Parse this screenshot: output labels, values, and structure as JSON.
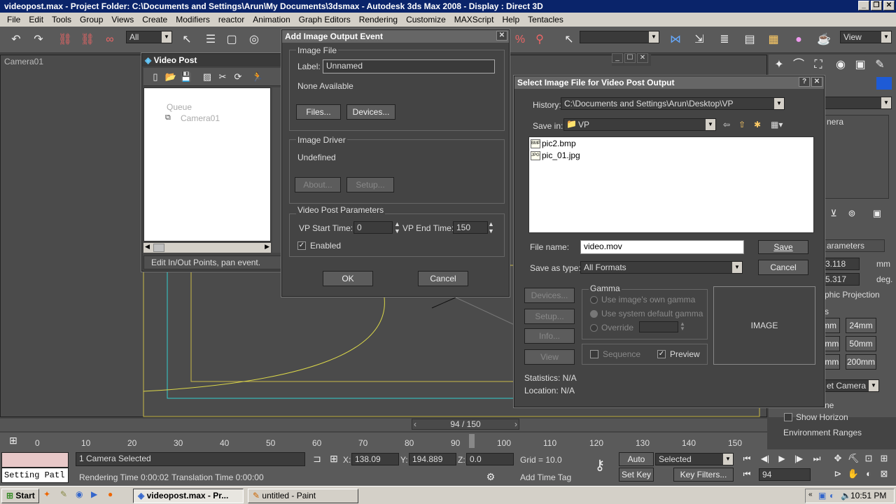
{
  "app": {
    "title": "videopost.max    - Project Folder: C:\\Documents and Settings\\Arun\\My Documents\\3dsmax     - Autodesk 3ds Max 2008      - Display : Direct 3D"
  },
  "menu": [
    "File",
    "Edit",
    "Tools",
    "Group",
    "Views",
    "Create",
    "Modifiers",
    "reactor",
    "Animation",
    "Graph Editors",
    "Rendering",
    "Customize",
    "MAXScript",
    "Help",
    "Tentacles"
  ],
  "toolbar": {
    "selection_filter": "All",
    "view_dropdown": "View"
  },
  "viewport": {
    "label": "Camera01"
  },
  "video_post": {
    "title": "Video Post",
    "queue_label": "Queue",
    "queue_item": "Camera01",
    "status": "Edit In/Out Points, pan event."
  },
  "add_output": {
    "title": "Add Image Output Event",
    "image_file_group": "Image File",
    "label_caption": "Label:",
    "label_value": "Unnamed",
    "none_available": "None Available",
    "files_btn": "Files...",
    "devices_btn": "Devices...",
    "image_driver_group": "Image Driver",
    "undefined": "Undefined",
    "about_btn": "About...",
    "setup_btn": "Setup...",
    "vp_params_group": "Video Post Parameters",
    "vp_start_label": "VP Start Time:",
    "vp_start_value": "0",
    "vp_end_label": "VP End Time:",
    "vp_end_value": "150",
    "enabled_label": "Enabled",
    "ok_btn": "OK",
    "cancel_btn": "Cancel"
  },
  "select_file": {
    "title": "Select Image File for Video Post Output",
    "help_btn": "?",
    "history_label": "History:",
    "history_value": "C:\\Documents and Settings\\Arun\\Desktop\\VP",
    "save_in_label": "Save in:",
    "save_in_value": "VP",
    "files": [
      {
        "name": "pic2.bmp",
        "tag": "BMP"
      },
      {
        "name": "pic_01.jpg",
        "tag": "JPG"
      }
    ],
    "file_name_label": "File name:",
    "file_name_value": "video.mov",
    "save_as_label": "Save as type:",
    "save_as_value": "All Formats",
    "save_btn": "Save",
    "cancel_btn": "Cancel",
    "devices_btn": "Devices...",
    "setup_btn": "Setup...",
    "info_btn": "Info...",
    "view_btn": "View",
    "gamma_group": "Gamma",
    "gamma_own": "Use image's own gamma",
    "gamma_system": "Use system default gamma",
    "gamma_override": "Override",
    "sequence_label": "Sequence",
    "preview_label": "Preview",
    "image_placeholder": "IMAGE",
    "statistics": "Statistics:  N/A",
    "location": "Location:  N/A"
  },
  "right_panel": {
    "camera_label": "nera",
    "params_label": "arameters",
    "lens_value": "3.118",
    "lens_unit": "mm",
    "fov_value": "5.317",
    "fov_unit": "deg.",
    "ortho_label": "phic Projection",
    "stock_label": "s",
    "lens_btns": [
      "mm",
      "24mm",
      "5mm",
      "50mm",
      "5mm",
      "200mm"
    ],
    "type_dropdown": "et Camera",
    "env_label": "ne",
    "show_horizon": "Show Horizon",
    "env_ranges": "Environment Ranges"
  },
  "timeline": {
    "frame": "94 / 150",
    "ticks": [
      "0",
      "10",
      "20",
      "30",
      "40",
      "50",
      "60",
      "70",
      "80",
      "90",
      "100",
      "110",
      "120",
      "130",
      "140",
      "150"
    ]
  },
  "status": {
    "maxscript": "Setting Patl",
    "selected": "1 Camera Selected",
    "render_time": "Rendering Time  0:00:02",
    "translation_time": "Translation Time  0:00:00",
    "x_label": "X:",
    "x_value": "138.09",
    "y_label": "Y:",
    "y_value": "194.889",
    "z_label": "Z:",
    "z_value": "0.0",
    "grid": "Grid = 10.0",
    "add_time_tag": "Add Time Tag",
    "auto_key": "Auto Key",
    "set_key": "Set Key",
    "selected_dd": "Selected",
    "key_filters": "Key Filters...",
    "frame_value": "94"
  },
  "taskbar": {
    "start": "Start",
    "task1": "videopost.max    - Pr...",
    "task2": "untitled - Paint",
    "clock": "10:51 PM"
  }
}
